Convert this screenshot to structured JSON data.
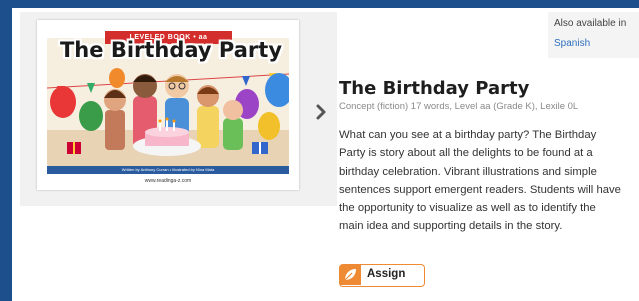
{
  "cover": {
    "series_label": "LEVELED BOOK • aa",
    "title": "The Birthday Party",
    "credits": "Written by Anthony Curran • Illustrated by Nina Mata",
    "url": "www.readinga-z.com"
  },
  "also_available": {
    "label": "Also available in",
    "language": "Spanish"
  },
  "book": {
    "title": "The Birthday Party",
    "meta": "Concept (fiction) 17 words, Level aa (Grade K), Lexile 0L",
    "description": "What can you see at a birthday party? The Birthday Party is story about all the delights to be found at a birthday celebration. Vibrant illustrations and simple sentences support emergent readers. Students will have the opportunity to visualize as well as to identify the main idea and supporting details in the story."
  },
  "actions": {
    "assign_label": "Assign"
  },
  "icons": {
    "next": "chevron-right-icon",
    "assign": "leaf-icon"
  },
  "colors": {
    "frame": "#1d4f8d",
    "accent": "#ee8a33",
    "link": "#2f6fbf"
  }
}
